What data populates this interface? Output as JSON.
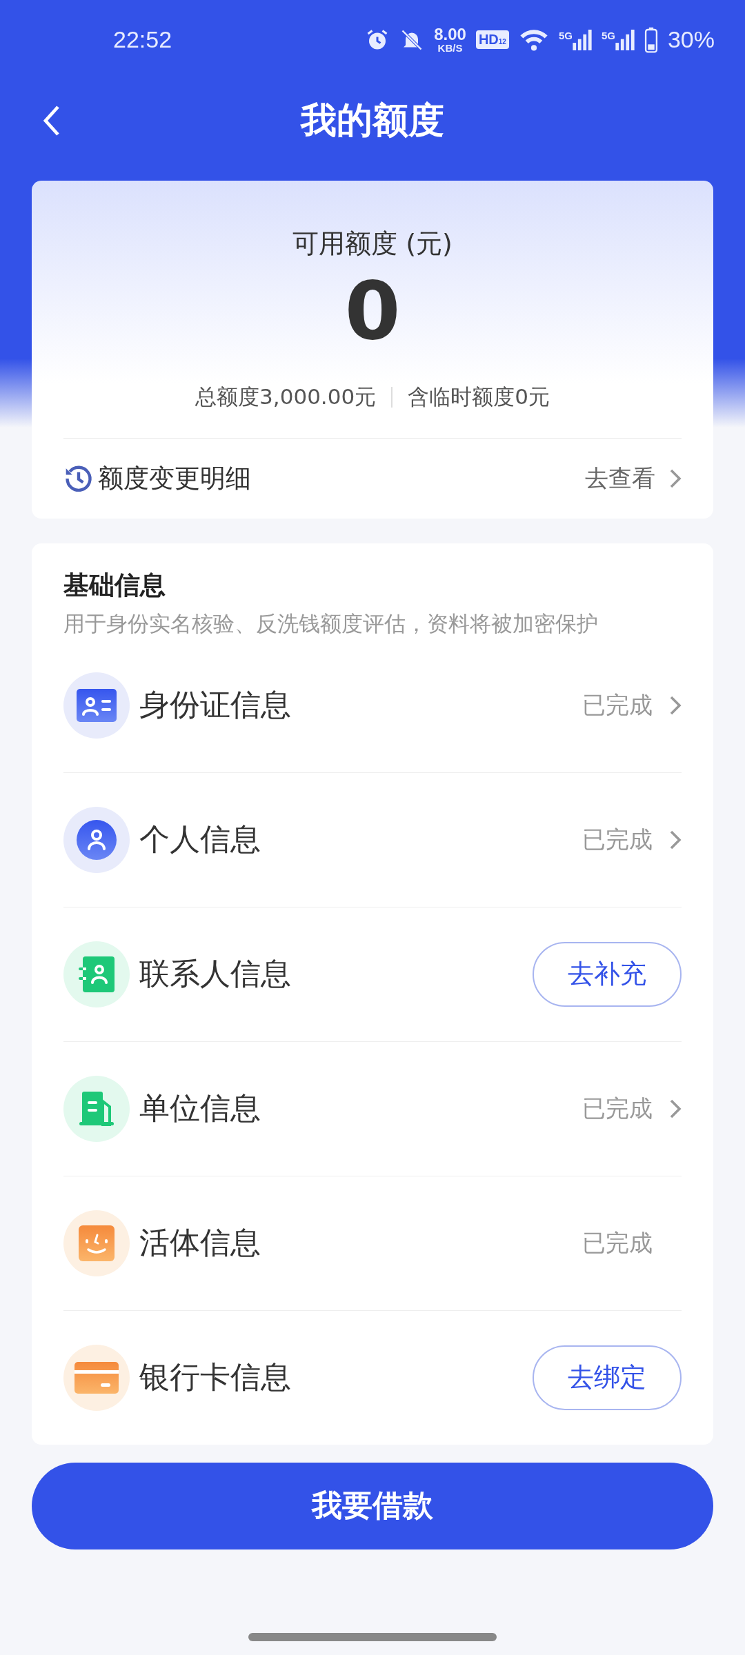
{
  "status_bar": {
    "time": "22:52",
    "net_speed": "8.00",
    "net_unit": "KB/S",
    "hd": "HD",
    "hd_sub": "1",
    "hd_sub2": "2",
    "sim": [
      "5G",
      "5G"
    ],
    "battery": "30%"
  },
  "header": {
    "title": "我的额度"
  },
  "quota": {
    "label": "可用额度 (元)",
    "amount": "0",
    "total": "总额度3,000.00元",
    "temp": "含临时额度0元",
    "history_label": "额度变更明细",
    "history_link": "去查看"
  },
  "basic_info": {
    "title": "基础信息",
    "subtitle": "用于身份实名核验、反洗钱额度评估，资料将被加密保护",
    "items": [
      {
        "label": "身份证信息",
        "kind": "status",
        "status": "已完成",
        "chevron": true
      },
      {
        "label": "个人信息",
        "kind": "status",
        "status": "已完成",
        "chevron": true
      },
      {
        "label": "联系人信息",
        "kind": "button",
        "action": "去补充"
      },
      {
        "label": "单位信息",
        "kind": "status",
        "status": "已完成",
        "chevron": true
      },
      {
        "label": "活体信息",
        "kind": "status",
        "status": "已完成",
        "chevron": false
      },
      {
        "label": "银行卡信息",
        "kind": "button",
        "action": "去绑定"
      }
    ]
  },
  "primary_button": "我要借款"
}
